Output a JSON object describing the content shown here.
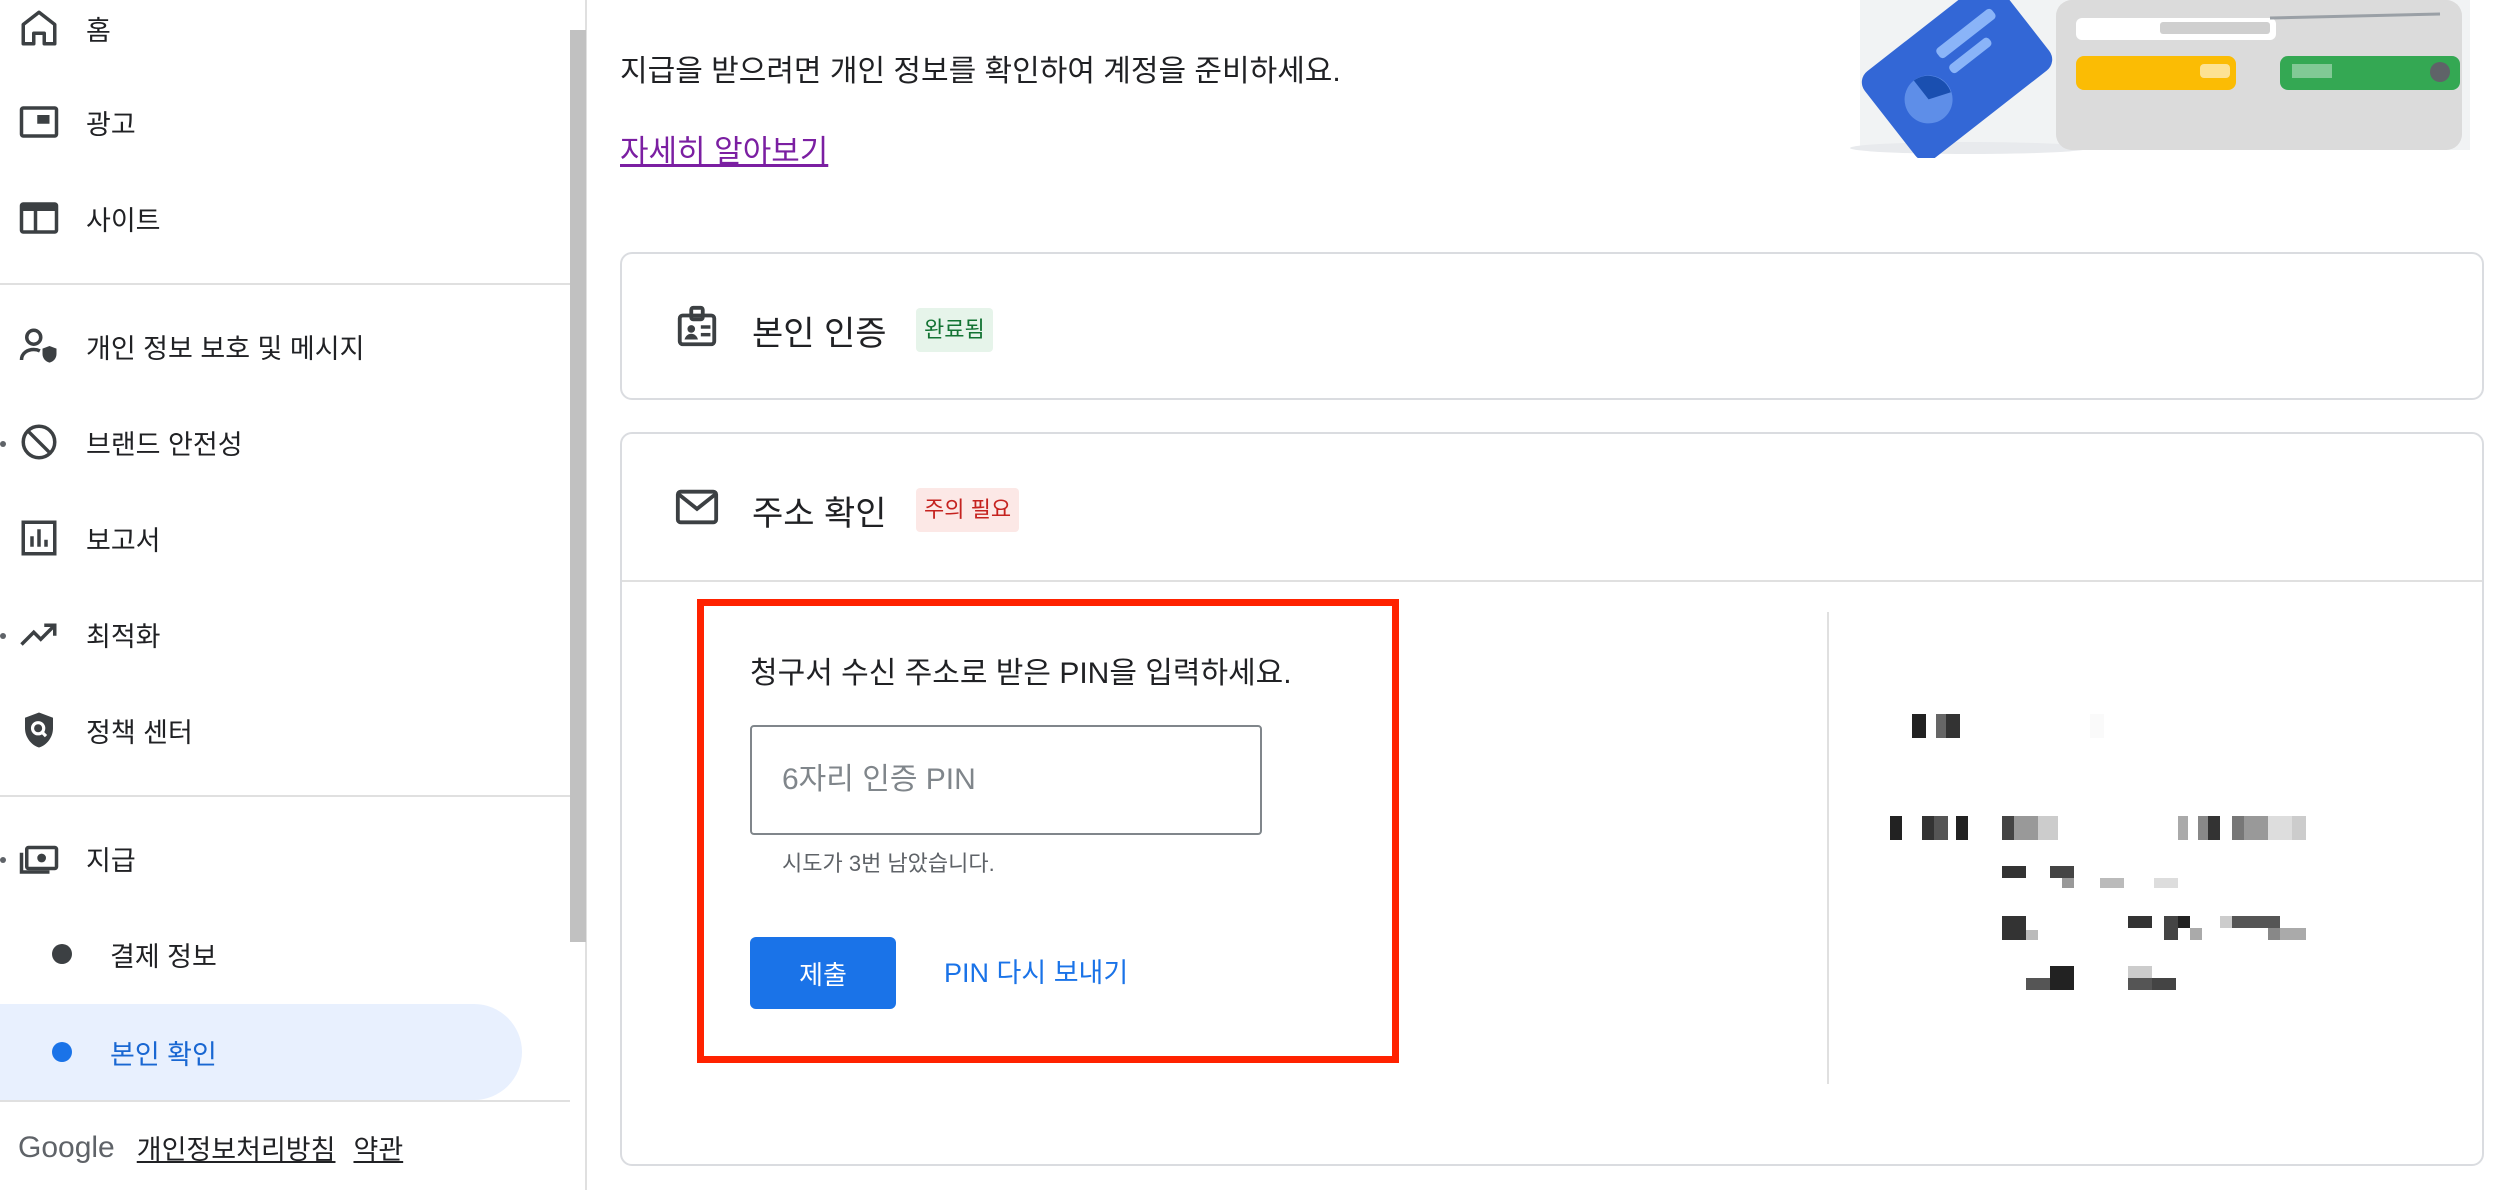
{
  "sidebar": {
    "items": [
      {
        "label": "홈",
        "icon": "home-icon"
      },
      {
        "label": "광고",
        "icon": "ads-icon"
      },
      {
        "label": "사이트",
        "icon": "sites-icon"
      },
      {
        "label": "개인 정보 보호 및 메시지",
        "icon": "privacy-messaging-icon"
      },
      {
        "label": "브랜드 안전성",
        "icon": "block-icon"
      },
      {
        "label": "보고서",
        "icon": "bar-chart-icon"
      },
      {
        "label": "최적화",
        "icon": "trending-up-icon"
      },
      {
        "label": "정책 센터",
        "icon": "policy-shield-icon"
      },
      {
        "label": "지급",
        "icon": "payments-icon"
      }
    ],
    "payments_sub": [
      {
        "label": "결제 정보",
        "active": false
      },
      {
        "label": "본인 확인",
        "active": true
      }
    ],
    "footer": {
      "brand": "Google",
      "privacy_link": "개인정보처리방침",
      "terms_link": "약관"
    }
  },
  "main": {
    "intro": "지급을 받으려면 개인 정보를 확인하여 계정을 준비하세요.",
    "learn_more": "자세히 알아보기",
    "identity_card": {
      "title": "본인 인증",
      "status": "완료됨",
      "status_color": "#137333",
      "icon": "id-badge-icon"
    },
    "address_card": {
      "title": "주소 확인",
      "status": "주의 필요",
      "status_color": "#c5221f",
      "icon": "mail-icon",
      "pin_prompt": "청구서 수신 주소로 받은 PIN을 입력하세요.",
      "pin_placeholder": "6자리 인증 PIN",
      "pin_value": "",
      "attempts_text": "시도가 3번 남았습니다.",
      "submit_label": "제출",
      "resend_label": "PIN 다시 보내기"
    }
  },
  "colors": {
    "primary": "#1a73e8",
    "highlight_box": "#ff2200",
    "active_nav_bg": "#e8f0fe",
    "link_visited": "#7b1fa2"
  }
}
